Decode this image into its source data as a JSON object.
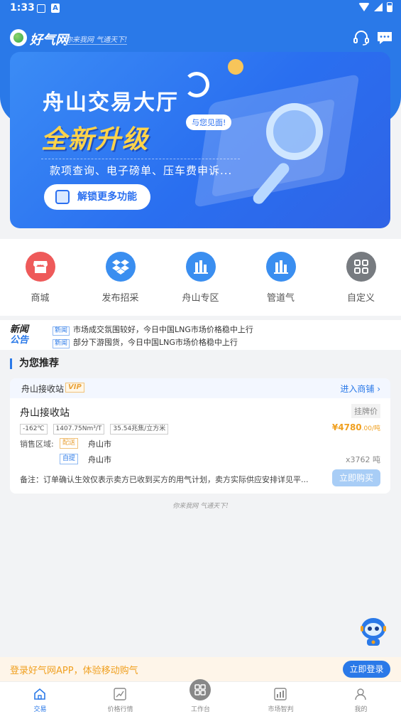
{
  "status_bar": {
    "time": "1:33",
    "notif_icon": "A"
  },
  "header": {
    "logo_text": "好气网",
    "slogan": "你来我网 气通天下!"
  },
  "banner": {
    "title": "舟山交易大厅",
    "subtitle": "全新升级",
    "tag": "与您见面!",
    "description": "款项查询、电子磅单、压车费申诉...",
    "button_label": "解锁更多功能"
  },
  "quick_menu": [
    {
      "label": "商城",
      "color": "#ee5a5a"
    },
    {
      "label": "发布招采",
      "color": "#3a8ef0"
    },
    {
      "label": "舟山专区",
      "color": "#3a8ef0"
    },
    {
      "label": "管道气",
      "color": "#3a8ef0"
    },
    {
      "label": "自定义",
      "color": "#777b80"
    }
  ],
  "news": {
    "logo_line1": "新闻",
    "logo_line2": "公告",
    "items": [
      {
        "tag": "新闻",
        "text": "市场成交氛围较好，今日中国LNG市场价格稳中上行"
      },
      {
        "tag": "新闻",
        "text": "部分下游囤货，今日中国LNG市场价格稳中上行"
      }
    ]
  },
  "recommend": {
    "title": "为您推荐",
    "card": {
      "shop_name": "舟山接收站",
      "vip": "VIP",
      "enter_shop": "进入商铺",
      "product_name": "舟山接收站",
      "price_type": "挂牌价",
      "specs": [
        "-162℃",
        "1407.75Nm³/T",
        "35.54兆焦/立方米"
      ],
      "price": "¥4780",
      "price_unit": ".00/吨",
      "area_label": "销售区域:",
      "delivery_tag": "配送",
      "delivery_area": "舟山市",
      "pickup_tag": "自提",
      "pickup_area": "舟山市",
      "quantity": "x3762 吨",
      "remark": "备注：订单确认生效仅表示卖方已收到买方的用气计划，卖方实际供应安排详见平...",
      "buy_label": "立即购买"
    }
  },
  "footer_slogan": "你来我网 气通天下!",
  "login_bar": {
    "text": "登录好气网APP，体验移动购气",
    "button": "立即登录"
  },
  "tabs": [
    {
      "label": "交易",
      "active": true
    },
    {
      "label": "价格行情",
      "active": false
    },
    {
      "label": "工作台",
      "active": false
    },
    {
      "label": "市场智判",
      "active": false
    },
    {
      "label": "我的",
      "active": false
    }
  ],
  "colors": {
    "primary": "#2a79e8",
    "accent": "#f0a020"
  }
}
